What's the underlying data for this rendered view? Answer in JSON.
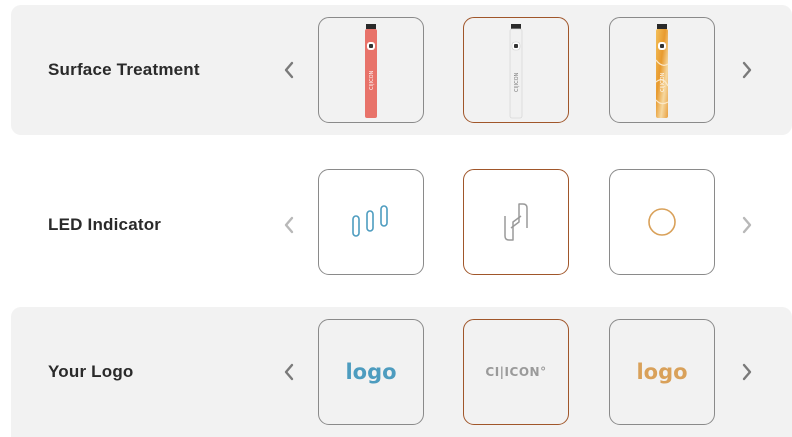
{
  "rows": [
    {
      "label": "Surface Treatment",
      "options": [
        {
          "name": "coral-pen",
          "color": "#e8736a"
        },
        {
          "name": "white-pen",
          "color": "#f1f1f1"
        },
        {
          "name": "amber-marble-pen",
          "color": "#e9a43a"
        }
      ],
      "pen_brand": "CI|ICON"
    },
    {
      "label": "LED Indicator",
      "options": [
        {
          "name": "three-bars-icon",
          "color": "#4d9cbf"
        },
        {
          "name": "interlock-icon",
          "color": "#9a9a9a"
        },
        {
          "name": "ring-icon",
          "color": "#d9a15a"
        }
      ]
    },
    {
      "label": "Your Logo",
      "options": [
        {
          "text": "logo",
          "color": "#4d9cbf"
        },
        {
          "text": "CI|ICON°",
          "color": "#9a9a9a"
        },
        {
          "text": "logo",
          "color": "#d9a15a"
        }
      ]
    }
  ],
  "colors": {
    "panel_bg": "#f2f2f2",
    "selected_border": "#a0562a",
    "card_border": "#8a8a8a"
  }
}
